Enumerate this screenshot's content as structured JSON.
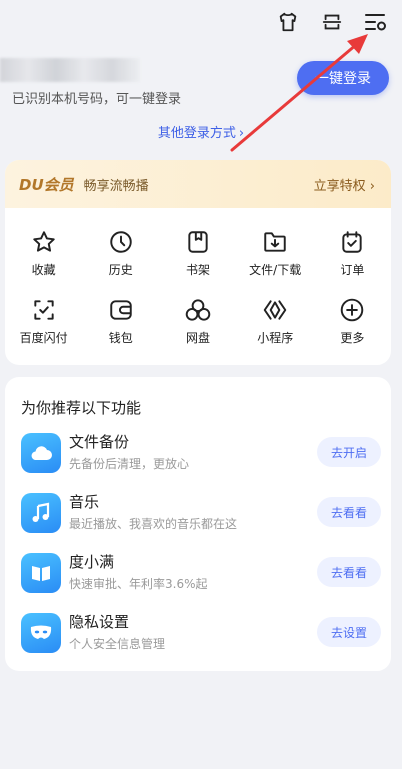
{
  "header": {
    "icons": [
      "tshirt-icon",
      "scan-icon",
      "settings-icon"
    ]
  },
  "login": {
    "hint": "已识别本机号码，可一键登录",
    "button": "一键登录",
    "other": "其他登录方式",
    "other_chevron": "›"
  },
  "vip": {
    "logo": "DU会员",
    "slogan": "畅享流畅播",
    "cta": "立享特权 ›"
  },
  "grid": [
    {
      "label": "收藏",
      "icon": "star-icon"
    },
    {
      "label": "历史",
      "icon": "clock-icon"
    },
    {
      "label": "书架",
      "icon": "bookmark-icon"
    },
    {
      "label": "文件/下载",
      "icon": "download-folder-icon"
    },
    {
      "label": "订单",
      "icon": "order-icon"
    },
    {
      "label": "百度闪付",
      "icon": "flash-pay-icon"
    },
    {
      "label": "钱包",
      "icon": "wallet-icon"
    },
    {
      "label": "网盘",
      "icon": "cloud-drive-icon"
    },
    {
      "label": "小程序",
      "icon": "mini-program-icon"
    },
    {
      "label": "更多",
      "icon": "plus-circle-icon"
    }
  ],
  "recommend": {
    "title": "为你推荐以下功能",
    "items": [
      {
        "name": "文件备份",
        "desc": "先备份后清理，更放心",
        "button": "去开启",
        "icon": "cloud-icon"
      },
      {
        "name": "音乐",
        "desc": "最近播放、我喜欢的音乐都在这",
        "button": "去看看",
        "icon": "music-note-icon"
      },
      {
        "name": "度小满",
        "desc": "快速审批、年利率3.6%起",
        "button": "去看看",
        "icon": "book-open-icon"
      },
      {
        "name": "隐私设置",
        "desc": "个人安全信息管理",
        "button": "去设置",
        "icon": "mask-icon"
      }
    ]
  },
  "colors": {
    "accent": "#4e6ef2",
    "arrow": "#e83a3a",
    "vip_text": "#8a5b1d"
  }
}
